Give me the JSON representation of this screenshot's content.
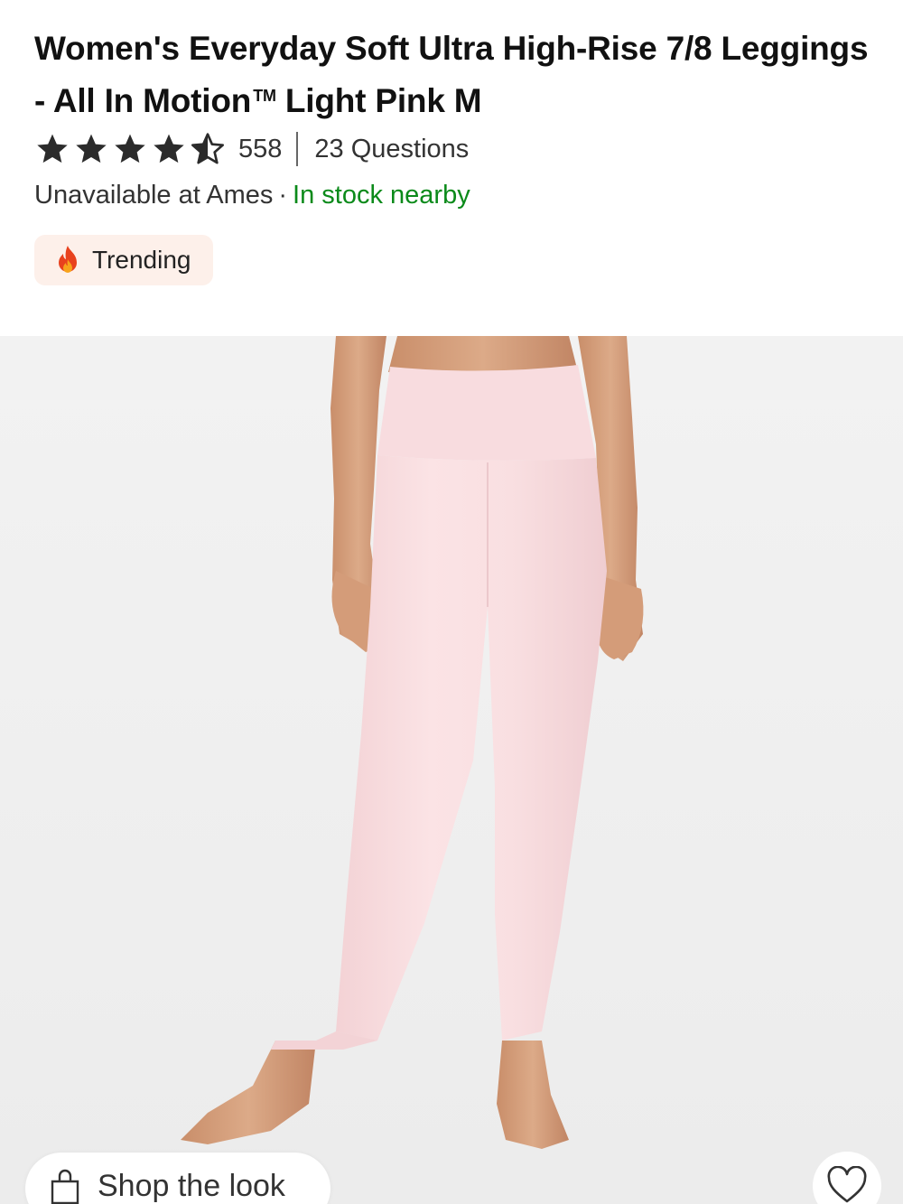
{
  "product": {
    "title": "Women's Everyday Soft Ultra High-Rise 7/8 Leggings - All In Motion",
    "trademark": "TM",
    "title_suffix": "Light Pink M"
  },
  "rating": {
    "stars": 4.5,
    "max_stars": 5,
    "review_count": "558",
    "questions": "23 Questions"
  },
  "availability": {
    "store_status": "Unavailable at Ames",
    "separator": "·",
    "nearby_status": "In stock nearby",
    "nearby_color": "#0b8a1a"
  },
  "badge": {
    "icon": "flame-icon",
    "label": "Trending"
  },
  "image": {
    "subject": "product-photo-leggings",
    "garment_color": "#f9dcdf"
  },
  "actions": {
    "shop_the_look": "Shop the look",
    "shop_icon": "shopping-bag-icon",
    "favorite_icon": "heart-icon"
  }
}
